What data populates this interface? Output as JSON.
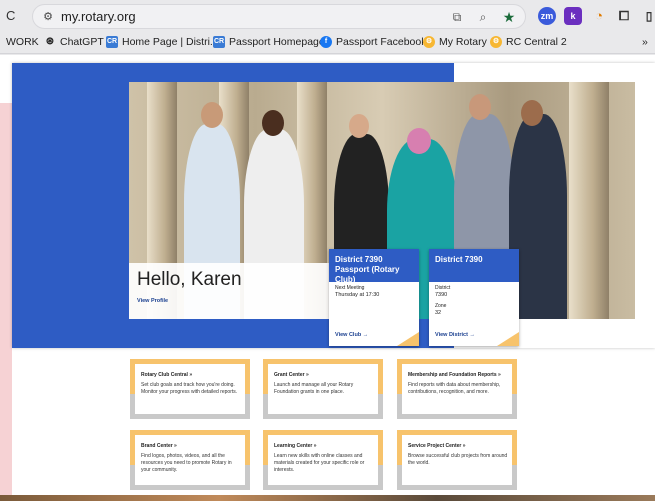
{
  "browser": {
    "url": "my.rotary.org",
    "bookmarks": [
      {
        "label": "WORK"
      },
      {
        "label": "ChatGPT"
      },
      {
        "label": "Home Page | Distri..."
      },
      {
        "label": "Passport Homepage"
      },
      {
        "label": "Passport Facebook"
      },
      {
        "label": "My Rotary"
      },
      {
        "label": "RC Central 2"
      },
      {
        "label": "»"
      }
    ],
    "extensions": [
      "zm",
      "k"
    ]
  },
  "hero": {
    "greeting": "Hello, Karen",
    "view_profile": "View Profile"
  },
  "club_card": {
    "title": "District 7390 Passport (Rotary Club)",
    "meeting_label": "Next Meeting",
    "meeting_value": "Thursday at 17:30",
    "link": "View Club →"
  },
  "district_card": {
    "title": "District 7390",
    "district_label": "District",
    "district_value": "7390",
    "zone_label": "Zone",
    "zone_value": "32",
    "link": "View District →"
  },
  "tiles": [
    {
      "title": "Rotary Club Central »",
      "desc": "Set club goals and track how you're doing. Monitor your progress with detailed reports."
    },
    {
      "title": "Grant Center »",
      "desc": "Launch and manage all your Rotary Foundation grants in one place."
    },
    {
      "title": "Membership and Foundation Reports »",
      "desc": "Find reports with data about membership, contributions, recognition, and more."
    },
    {
      "title": "Brand Center »",
      "desc": "Find logos, photos, videos, and all the resources you need to promote Rotary in your community."
    },
    {
      "title": "Learning Center »",
      "desc": "Learn new skills with online classes and materials created for your specific role or interests."
    },
    {
      "title": "Service Project Center »",
      "desc": "Browse successful club projects from around the world."
    }
  ]
}
